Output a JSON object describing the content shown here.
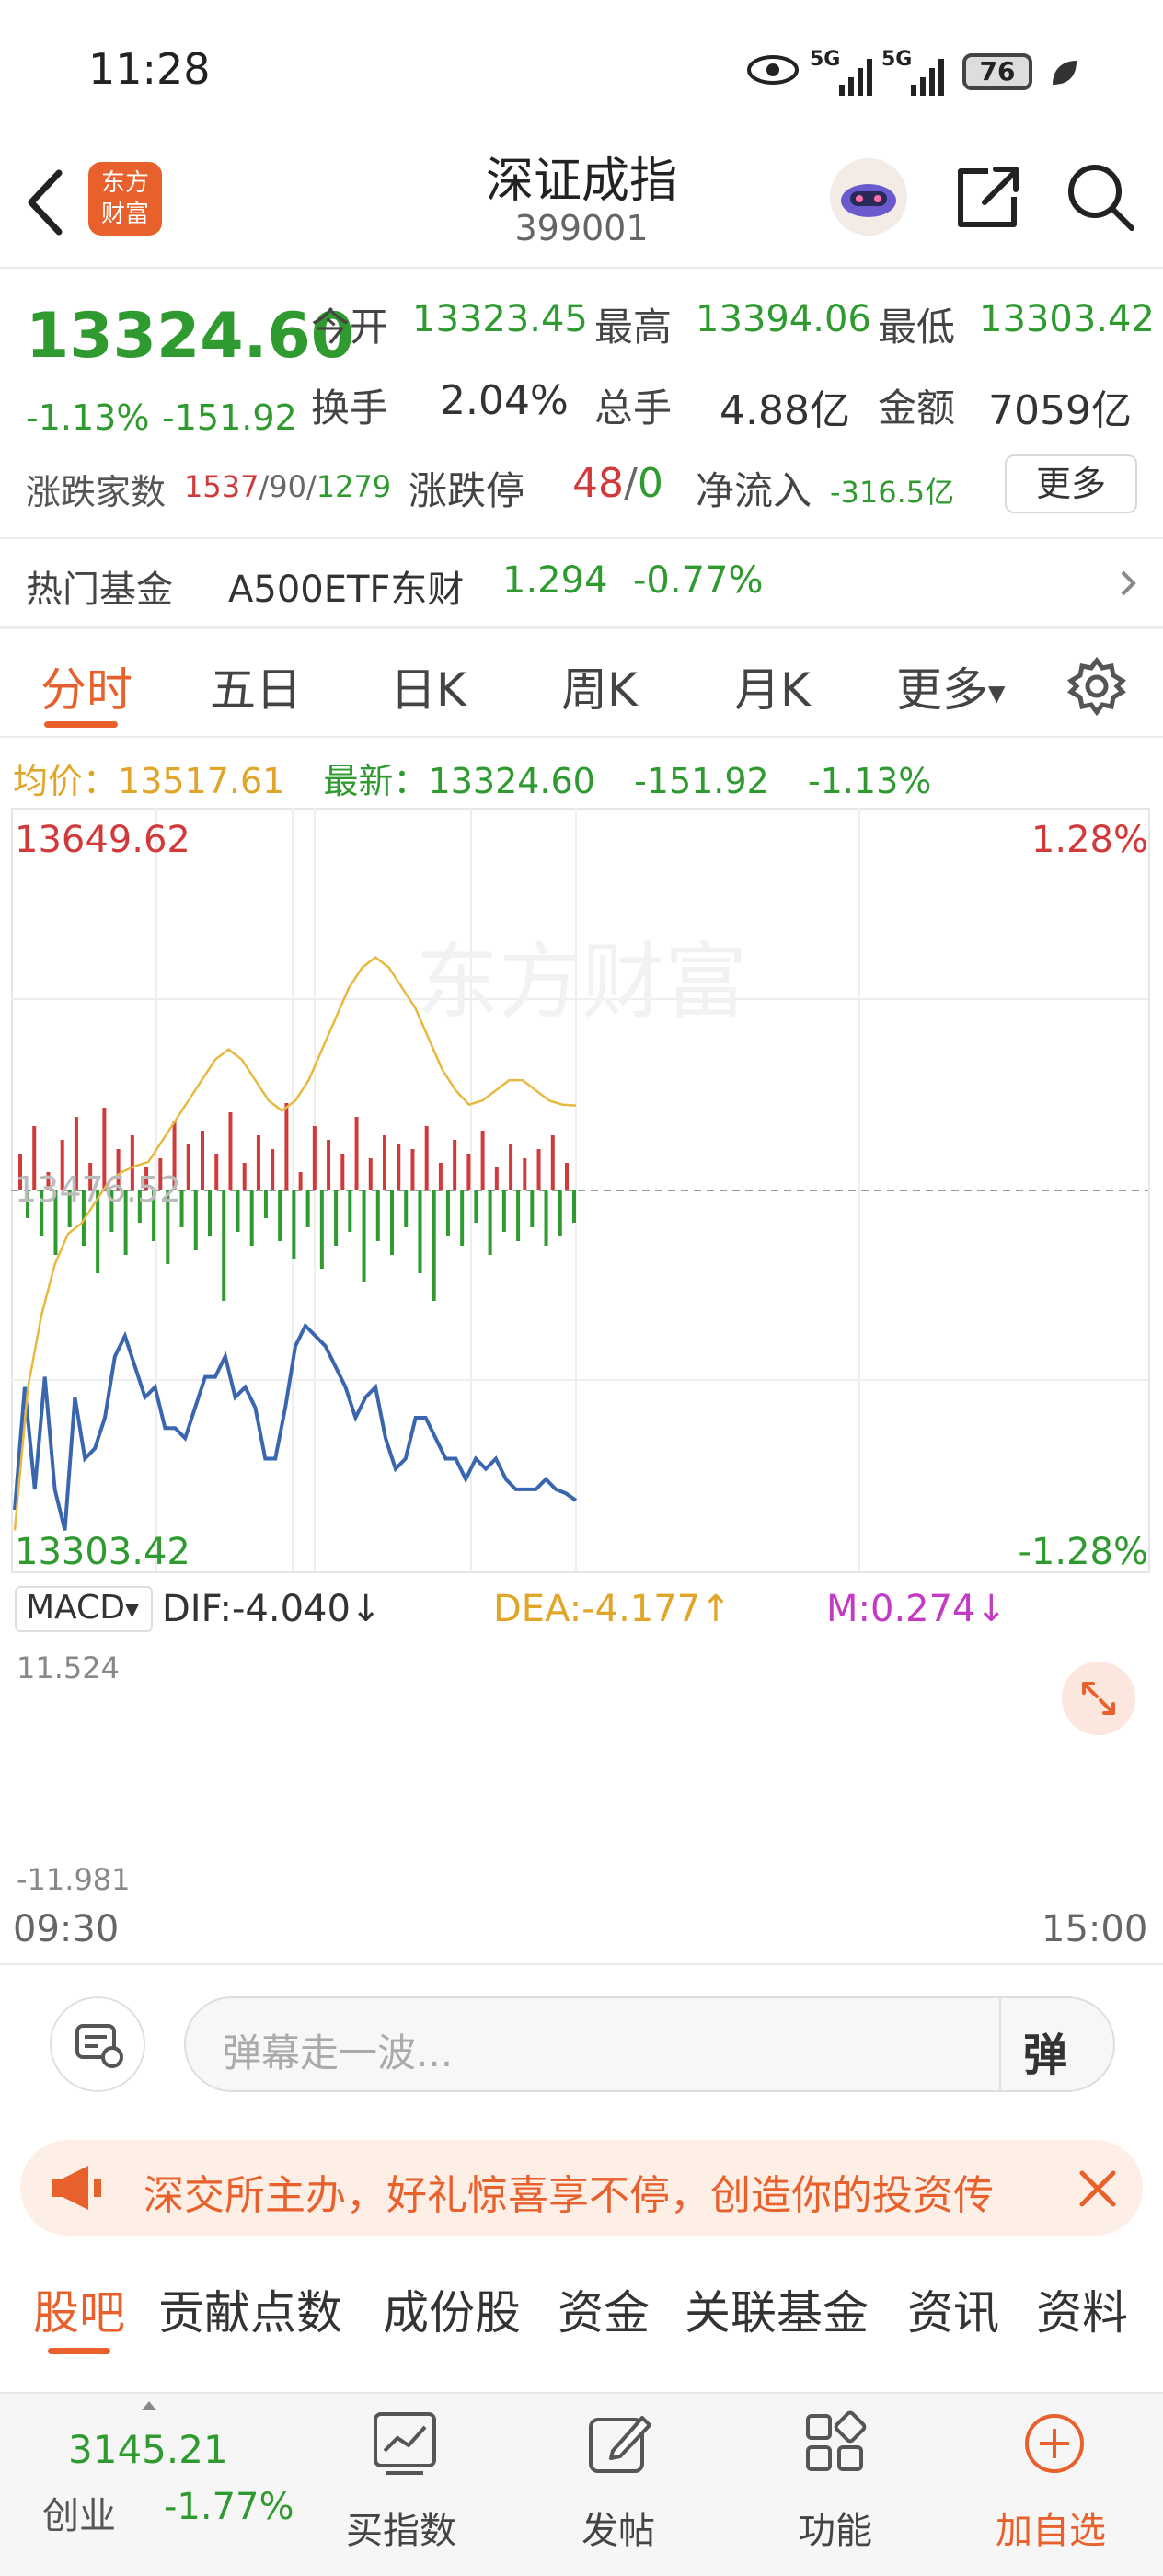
{
  "status_bar": {
    "time": "11:28",
    "battery": "76",
    "net1": "5G",
    "net2": "5G"
  },
  "header": {
    "logo_line1": "东方",
    "logo_line2": "财富",
    "title": "深证成指",
    "code": "399001"
  },
  "quote": {
    "price": "13324.60",
    "change_pct": "-1.13%",
    "change": "-151.92",
    "open_label": "今开",
    "open": "13323.45",
    "high_label": "最高",
    "high": "13394.06",
    "low_label": "最低",
    "low": "13303.42",
    "turnover_label": "换手",
    "turnover": "2.04%",
    "volume_label": "总手",
    "volume": "4.88亿",
    "amount_label": "金额",
    "amount": "7059亿",
    "adv_label": "涨跌家数",
    "adv_up": "1537",
    "adv_sep1": "/",
    "adv_flat": "90",
    "adv_sep2": "/",
    "adv_down": "1279",
    "limit_label": "涨跌停",
    "limit_up": "48",
    "limit_sep": "/",
    "limit_down": "0",
    "inflow_label": "净流入",
    "inflow": "-316.5亿",
    "more_button": "更多"
  },
  "hot_fund": {
    "label": "热门基金",
    "name": "A500ETF东财",
    "price": "1.294",
    "change": "-0.77%"
  },
  "chart_tabs": [
    "分时",
    "五日",
    "日K",
    "周K",
    "月K",
    "更多"
  ],
  "legend": {
    "avg_label": "均价：",
    "avg": "13517.61",
    "latest_label": "最新：",
    "latest": "13324.60",
    "change": "-151.92",
    "pct": "-1.13%"
  },
  "chart_labels": {
    "top_price": "13649.62",
    "top_pct": "1.28%",
    "mid_price": "13476.52",
    "bottom_price": "13303.42",
    "bottom_pct": "-1.28%",
    "watermark": "东方财富"
  },
  "macd": {
    "name": "MACD",
    "dif": "DIF:-4.040",
    "dea": "DEA:-4.177",
    "m": "M:0.274",
    "top": "11.524",
    "bottom": "-11.981"
  },
  "time_axis": {
    "start": "09:30",
    "end": "15:00"
  },
  "danmaku": {
    "placeholder": "弹幕走一波...",
    "button": "弹"
  },
  "banner": {
    "text": "深交所主办，好礼惊喜享不停，创造你的投资传"
  },
  "bottom_tabs": [
    "股吧",
    "贡献点数",
    "成份股",
    "资金",
    "关联基金",
    "资讯",
    "资料"
  ],
  "bottom_nav": {
    "index_value": "3145.21",
    "index_name": "创业",
    "index_change": "-1.77%",
    "buy_index": "买指数",
    "post": "发帖",
    "function": "功能",
    "add_watch": "加自选"
  },
  "colors": {
    "up": "#d13a3a",
    "down": "#2f9a2f",
    "accent": "#e8612c",
    "avg_line": "#e8b940",
    "price_line": "#3a66b0"
  },
  "chart_data": {
    "type": "line",
    "title": "深证成指 分时",
    "ylim": [
      13303.42,
      13649.62
    ],
    "prev_close": 13476.52,
    "x_range": [
      "09:30",
      "15:00"
    ],
    "series": [
      {
        "name": "最新",
        "values": [
          13320,
          13380,
          13330,
          13385,
          13330,
          13310,
          13375,
          13345,
          13350,
          13365,
          13395,
          13405,
          13390,
          13375,
          13380,
          13360,
          13360,
          13355,
          13370,
          13385,
          13385,
          13395,
          13375,
          13380,
          13370,
          13345,
          13345,
          13370,
          13400,
          13410,
          13405,
          13400,
          13390,
          13380,
          13365,
          13375,
          13380,
          13355,
          13340,
          13345,
          13365,
          13365,
          13355,
          13345,
          13345,
          13335,
          13345,
          13340,
          13345,
          13335,
          13330,
          13330,
          13330,
          13335,
          13330,
          13328,
          13324.6
        ]
      },
      {
        "name": "均价",
        "values": [
          13310,
          13380,
          13415,
          13440,
          13455,
          13460,
          13470,
          13480,
          13485,
          13488,
          13490,
          13500,
          13510,
          13520,
          13530,
          13540,
          13545,
          13540,
          13530,
          13520,
          13515,
          13520,
          13530,
          13545,
          13560,
          13575,
          13585,
          13590,
          13585,
          13575,
          13565,
          13550,
          13535,
          13525,
          13518,
          13520,
          13525,
          13530,
          13530,
          13525,
          13520,
          13518,
          13517.61
        ]
      }
    ]
  }
}
